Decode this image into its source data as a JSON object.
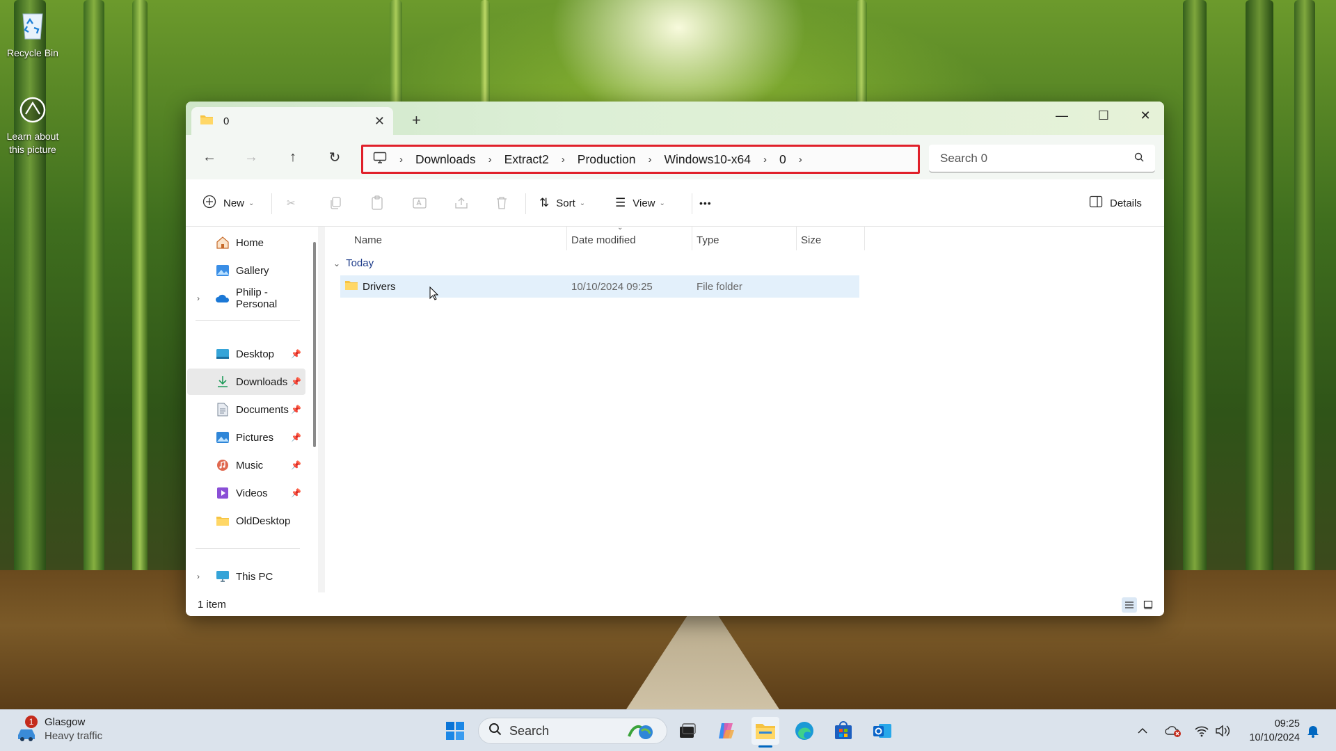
{
  "desktop": {
    "icons": [
      {
        "label": "Recycle Bin"
      },
      {
        "label": "Learn about this picture"
      }
    ]
  },
  "window": {
    "tab_title": "0",
    "new_tab": "+",
    "controls": {
      "minimize": "—",
      "maximize": "☐",
      "close": "✕"
    }
  },
  "nav": {
    "breadcrumbs": [
      "Downloads",
      "Extract2",
      "Production",
      "Windows10-x64",
      "0"
    ],
    "search_placeholder": "Search 0"
  },
  "toolbar": {
    "new_label": "New",
    "sort_label": "Sort",
    "view_label": "View",
    "more_label": "•••",
    "details_label": "Details"
  },
  "sidebar": {
    "items": [
      {
        "label": "Home",
        "icon": "home-icon"
      },
      {
        "label": "Gallery",
        "icon": "gallery-icon"
      },
      {
        "label": "Philip - Personal",
        "icon": "onedrive-icon"
      },
      {
        "label": "Desktop",
        "icon": "desktop-icon"
      },
      {
        "label": "Downloads",
        "icon": "downloads-icon"
      },
      {
        "label": "Documents",
        "icon": "documents-icon"
      },
      {
        "label": "Pictures",
        "icon": "pictures-icon"
      },
      {
        "label": "Music",
        "icon": "music-icon"
      },
      {
        "label": "Videos",
        "icon": "videos-icon"
      },
      {
        "label": "OldDesktop",
        "icon": "folder-icon"
      },
      {
        "label": "This PC",
        "icon": "this-pc-icon"
      }
    ]
  },
  "list": {
    "columns": [
      "Name",
      "Date modified",
      "Type",
      "Size"
    ],
    "group": "Today",
    "rows": [
      {
        "name": "Drivers",
        "date": "10/10/2024 09:25",
        "type": "File folder",
        "size": ""
      }
    ]
  },
  "status": {
    "count": "1 item"
  },
  "taskbar": {
    "weather_city": "Glasgow",
    "weather_status": "Heavy traffic",
    "weather_badge": "1",
    "search_label": "Search",
    "time": "09:25",
    "date": "10/10/2024"
  },
  "colors": {
    "accent": "#0067c0",
    "highlight_border": "#e0202a",
    "selection": "#e3f0fb"
  }
}
